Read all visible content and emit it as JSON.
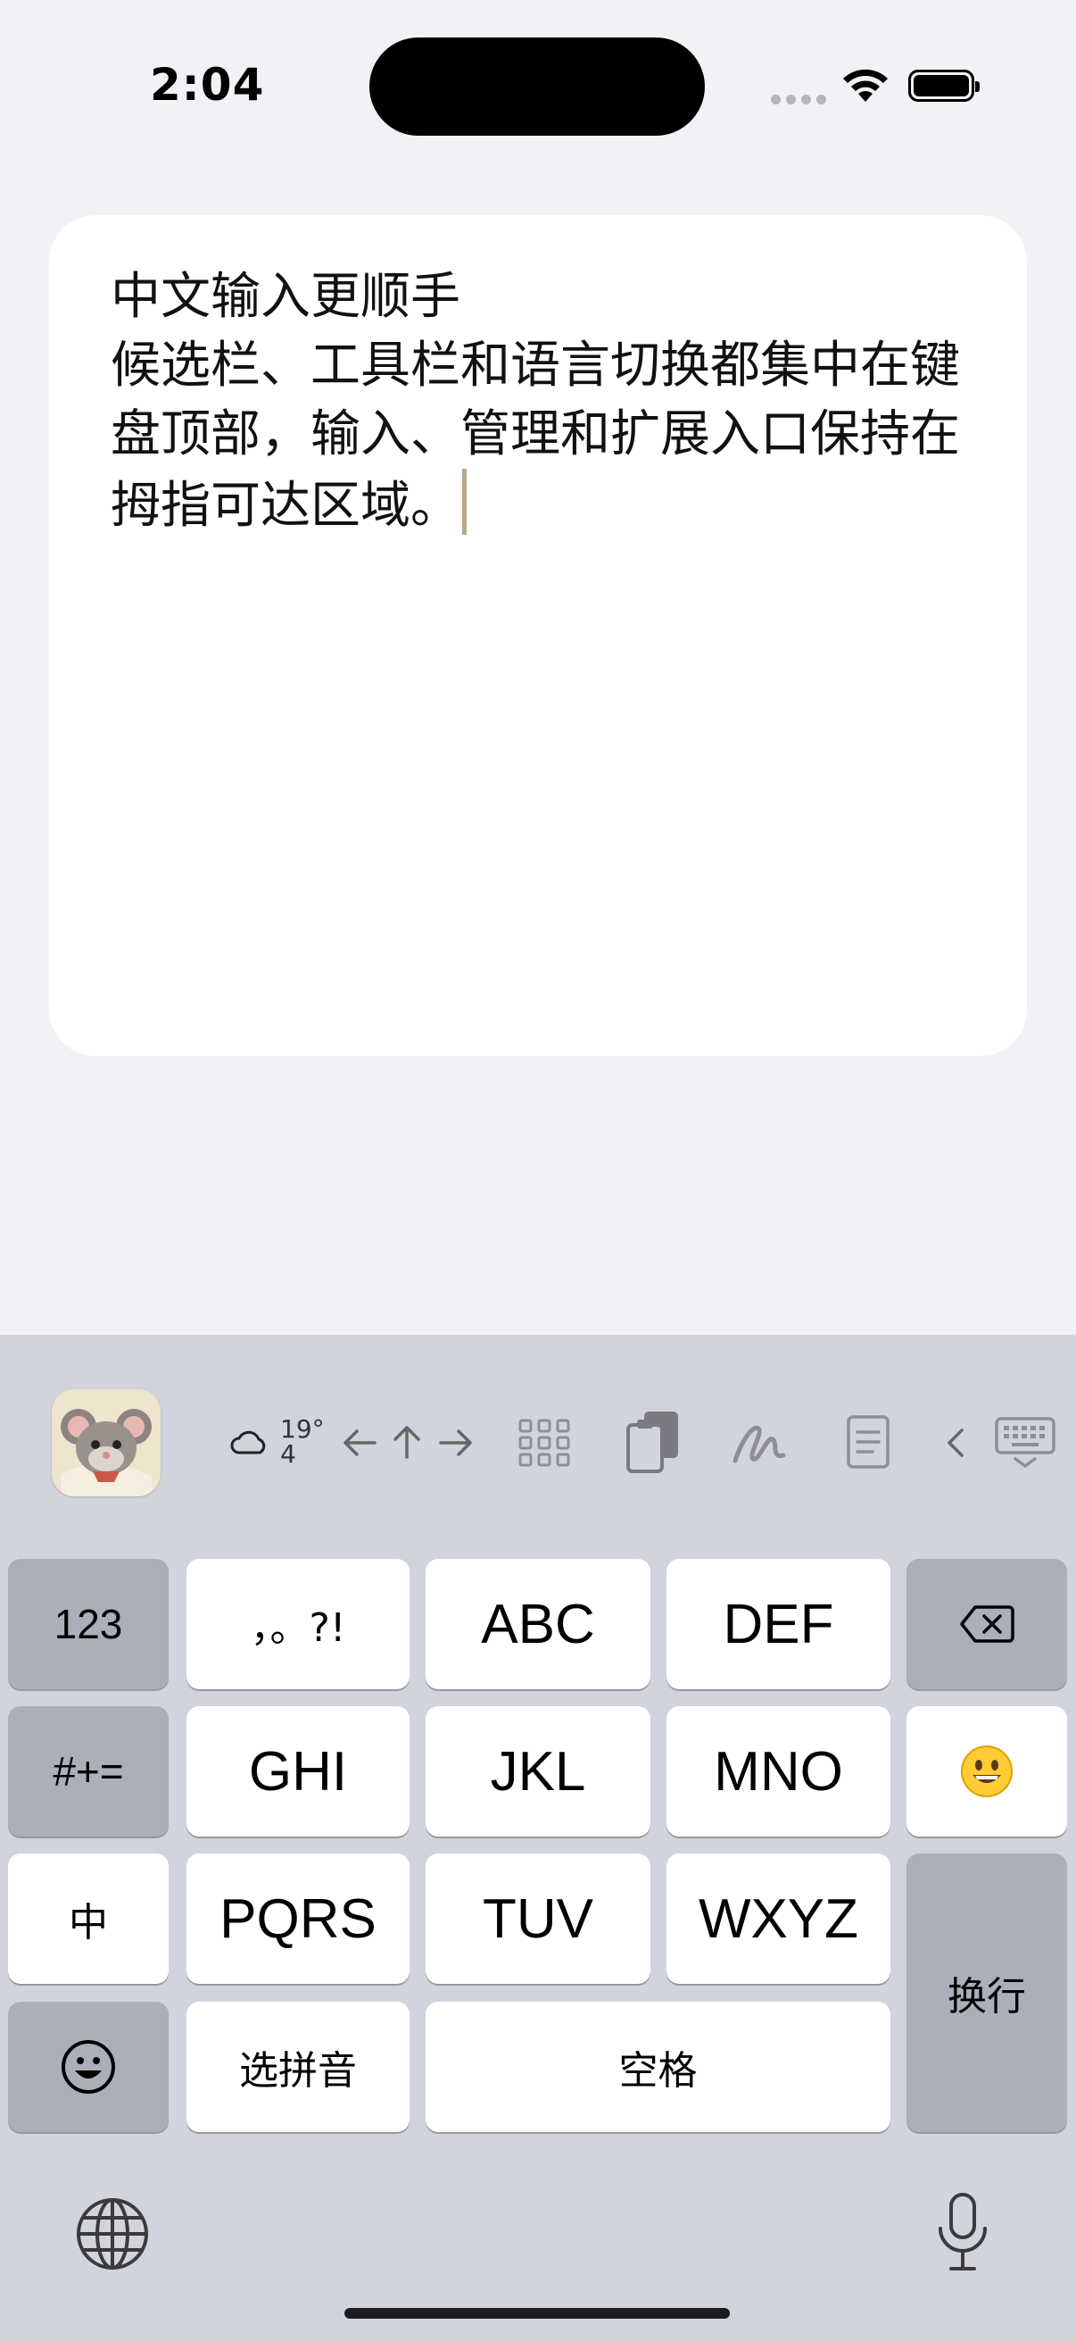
{
  "status_bar": {
    "time": "2:04"
  },
  "editor": {
    "text": "中文输入更顺手\n候选栏、工具栏和语言切换都集中在键盘顶部，输入、管理和扩展入口保持在拇指可达区域。"
  },
  "toolbar": {
    "weather_temp": "19°",
    "weather_sub": "4",
    "icons": [
      "mascot-icon",
      "cloud-icon",
      "arrow-left-icon",
      "arrow-up-icon",
      "arrow-right-icon",
      "grid-icon",
      "clipboard-icon",
      "handwriting-icon",
      "notes-icon",
      "chevron-left-icon",
      "keyboard-dismiss-icon"
    ]
  },
  "keys": {
    "num": "123",
    "punct": "，。?!",
    "abc": "ABC",
    "def": "DEF",
    "symbols": "#+=",
    "ghi": "GHI",
    "jkl": "JKL",
    "mno": "MNO",
    "emoji_face": "😀",
    "zh": "中",
    "pqrs": "PQRS",
    "tuv": "TUV",
    "wxyz": "WXYZ",
    "newline": "换行",
    "pinyin": "选拼音",
    "space": "空格"
  }
}
